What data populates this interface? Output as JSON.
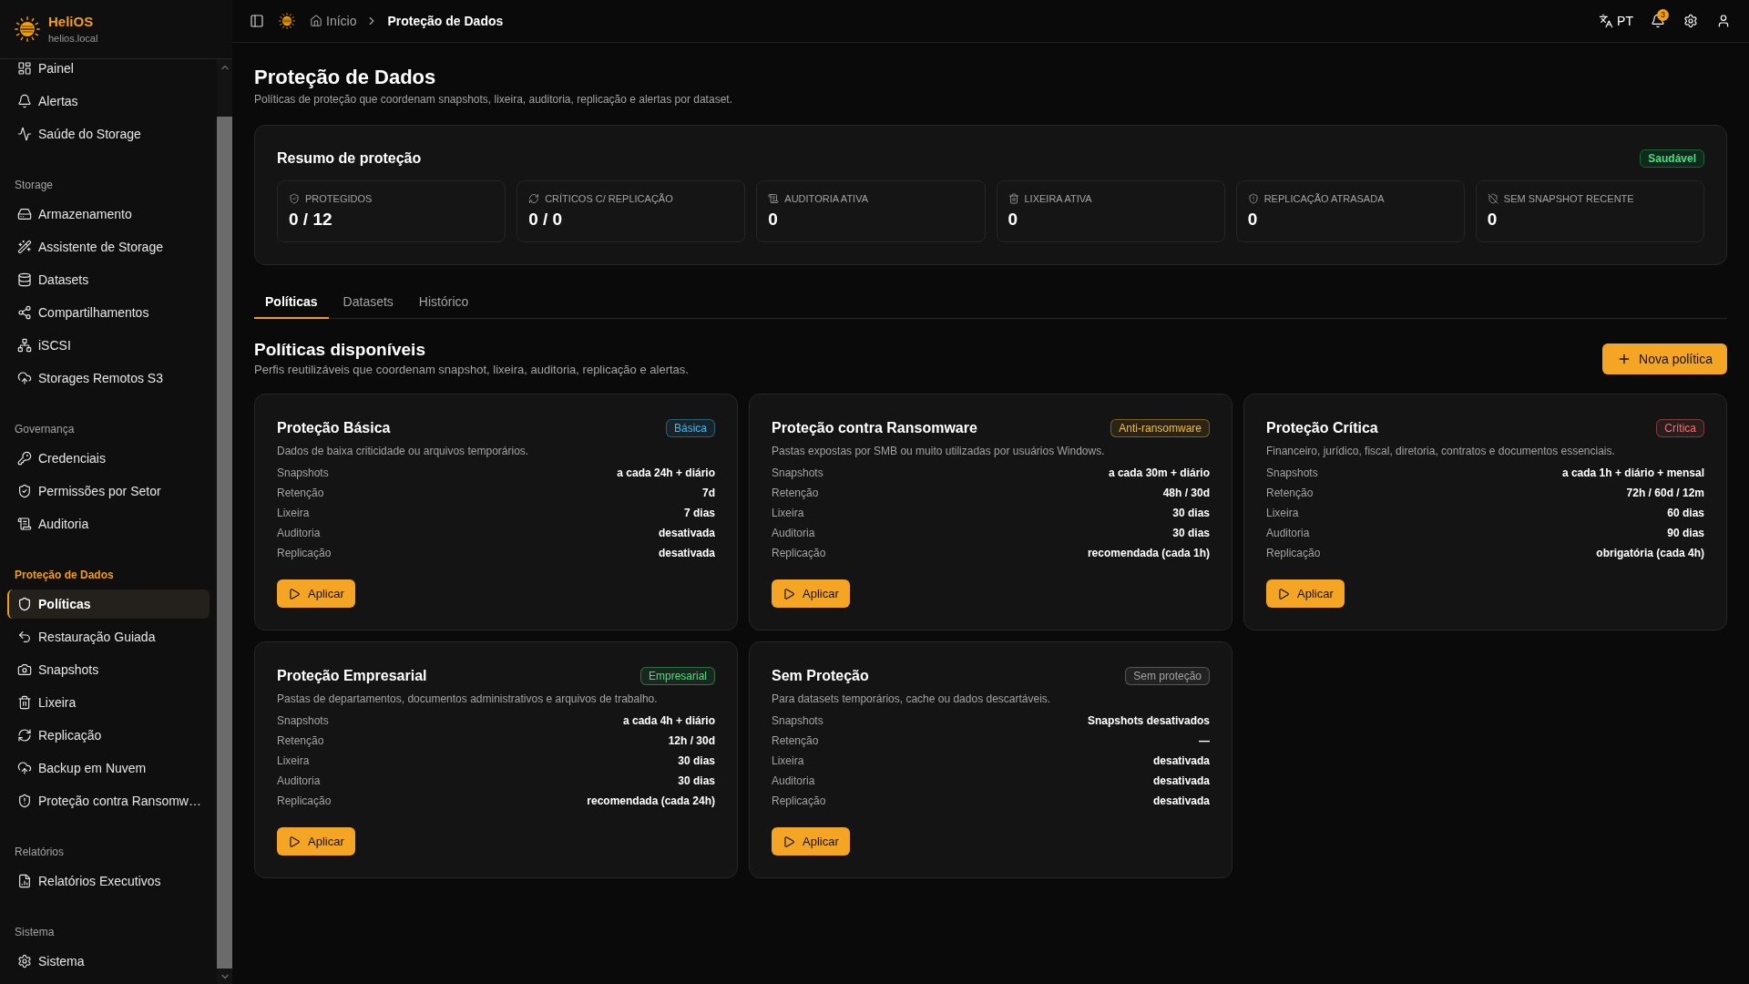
{
  "sidebar": {
    "brand": {
      "name": "HeliOS",
      "host": "helios.local"
    },
    "sections": [
      {
        "items": [
          {
            "label": "Painel",
            "selected": false
          },
          {
            "label": "Alertas",
            "selected": false
          },
          {
            "label": "Saúde do Storage",
            "selected": false
          }
        ]
      },
      {
        "title": "Storage",
        "items": [
          {
            "label": "Armazenamento",
            "selected": false
          },
          {
            "label": "Assistente de Storage",
            "selected": false
          },
          {
            "label": "Datasets",
            "selected": false
          },
          {
            "label": "Compartilhamentos",
            "selected": false
          },
          {
            "label": "iSCSI",
            "selected": false
          },
          {
            "label": "Storages Remotos S3",
            "selected": false
          }
        ]
      },
      {
        "title": "Governança",
        "items": [
          {
            "label": "Credenciais",
            "selected": false
          },
          {
            "label": "Permissões por Setor",
            "selected": false
          },
          {
            "label": "Auditoria",
            "selected": false
          }
        ]
      },
      {
        "title": "Proteção de Dados",
        "items": [
          {
            "label": "Políticas",
            "selected": true
          },
          {
            "label": "Restauração Guiada",
            "selected": false
          },
          {
            "label": "Snapshots",
            "selected": false
          },
          {
            "label": "Lixeira",
            "selected": false
          },
          {
            "label": "Replicação",
            "selected": false
          },
          {
            "label": "Backup em Nuvem",
            "selected": false
          },
          {
            "label": "Proteção contra Ransomw…",
            "selected": false
          }
        ]
      },
      {
        "title": "Relatórios",
        "items": [
          {
            "label": "Relatórios Executivos",
            "selected": false
          }
        ]
      },
      {
        "title": "Sistema",
        "items": [
          {
            "label": "Sistema",
            "selected": false
          }
        ]
      }
    ]
  },
  "topbar": {
    "breadcrumb": [
      {
        "label": "Início"
      },
      {
        "label": "Proteção de Dados"
      }
    ],
    "language": "PT",
    "notifications": "3"
  },
  "page": {
    "title": "Proteção de Dados",
    "subtitle": "Políticas de proteção que coordenam snapshots, lixeira, auditoria, replicação e alertas por dataset."
  },
  "summary": {
    "title": "Resumo de proteção",
    "status": "Saudável",
    "stats": [
      {
        "label": "PROTEGIDOS",
        "value": "0 / 12"
      },
      {
        "label": "CRÍTICOS C/ REPLICAÇÃO",
        "value": "0 / 0"
      },
      {
        "label": "AUDITORIA ATIVA",
        "value": "0"
      },
      {
        "label": "LIXEIRA ATIVA",
        "value": "0"
      },
      {
        "label": "REPLICAÇÃO ATRASADA",
        "value": "0"
      },
      {
        "label": "SEM SNAPSHOT RECENTE",
        "value": "0"
      }
    ]
  },
  "tabs": [
    {
      "label": "Políticas",
      "selected": true
    },
    {
      "label": "Datasets",
      "selected": false
    },
    {
      "label": "Histórico",
      "selected": false
    }
  ],
  "policies_section": {
    "title": "Políticas disponíveis",
    "subtitle": "Perfis reutilizáveis que coordenam snapshot, lixeira, auditoria, replicação e alertas.",
    "new_button": "Nova política"
  },
  "policies": [
    {
      "title": "Proteção Básica",
      "badge": {
        "label": "Básica",
        "color": "#38bdf8"
      },
      "description": "Dados de baixa criticidade ou arquivos temporários.",
      "rows": [
        {
          "label": "Snapshots",
          "value": "a cada 24h + diário"
        },
        {
          "label": "Retenção",
          "value": "7d"
        },
        {
          "label": "Lixeira",
          "value": "7 dias"
        },
        {
          "label": "Auditoria",
          "value": "desativada"
        },
        {
          "label": "Replicação",
          "value": "desativada"
        }
      ],
      "apply_button": "Aplicar"
    },
    {
      "title": "Proteção contra Ransomware",
      "badge": {
        "label": "Anti-ransomware",
        "color": "#fbbf24"
      },
      "description": "Pastas expostas por SMB ou muito utilizadas por usuários Windows.",
      "rows": [
        {
          "label": "Snapshots",
          "value": "a cada 30m + diário"
        },
        {
          "label": "Retenção",
          "value": "48h / 30d"
        },
        {
          "label": "Lixeira",
          "value": "30 dias"
        },
        {
          "label": "Auditoria",
          "value": "30 dias"
        },
        {
          "label": "Replicação",
          "value": "recomendada (cada 1h)"
        }
      ],
      "apply_button": "Aplicar"
    },
    {
      "title": "Proteção Crítica",
      "badge": {
        "label": "Crítica",
        "color": "#f87171"
      },
      "description": "Financeiro, jurídico, fiscal, diretoria, contratos e documentos essenciais.",
      "rows": [
        {
          "label": "Snapshots",
          "value": "a cada 1h + diário + mensal"
        },
        {
          "label": "Retenção",
          "value": "72h / 60d / 12m"
        },
        {
          "label": "Lixeira",
          "value": "60 dias"
        },
        {
          "label": "Auditoria",
          "value": "90 dias"
        },
        {
          "label": "Replicação",
          "value": "obrigatória (cada 4h)"
        }
      ],
      "apply_button": "Aplicar"
    },
    {
      "title": "Proteção Empresarial",
      "badge": {
        "label": "Empresarial",
        "color": "#4ade80"
      },
      "description": "Pastas de departamentos, documentos administrativos e arquivos de trabalho.",
      "rows": [
        {
          "label": "Snapshots",
          "value": "a cada 4h + diário"
        },
        {
          "label": "Retenção",
          "value": "12h / 30d"
        },
        {
          "label": "Lixeira",
          "value": "30 dias"
        },
        {
          "label": "Auditoria",
          "value": "30 dias"
        },
        {
          "label": "Replicação",
          "value": "recomendada (cada 24h)"
        }
      ],
      "apply_button": "Aplicar"
    },
    {
      "title": "Sem Proteção",
      "badge": {
        "label": "Sem proteção",
        "color": "#a3a3a3"
      },
      "description": "Para datasets temporários, cache ou dados descartáveis.",
      "rows": [
        {
          "label": "Snapshots",
          "value": "Snapshots desativados"
        },
        {
          "label": "Retenção",
          "value": "—"
        },
        {
          "label": "Lixeira",
          "value": "desativada"
        },
        {
          "label": "Auditoria",
          "value": "desativada"
        },
        {
          "label": "Replicação",
          "value": "desativada"
        }
      ],
      "apply_button": "Aplicar"
    }
  ]
}
